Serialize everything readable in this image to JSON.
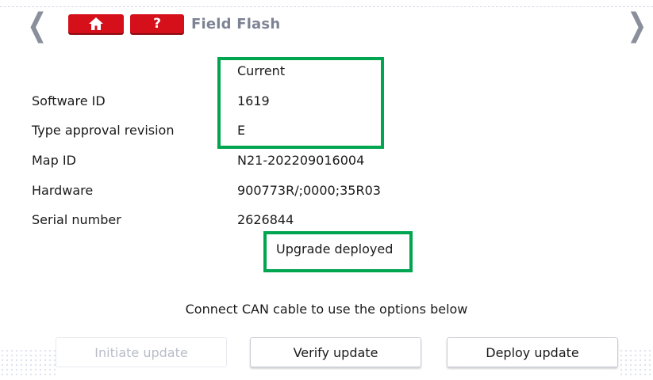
{
  "header": {
    "title": "Field Flash",
    "help_label": "?",
    "icons": {
      "back": "chevron-left-icon",
      "forward": "chevron-right-icon",
      "home": "home-icon"
    }
  },
  "info": {
    "column_header": "Current",
    "rows": [
      {
        "label": "Software ID",
        "value": "1619"
      },
      {
        "label": "Type approval revision",
        "value": "E"
      },
      {
        "label": "Map ID",
        "value": "N21-202209016004"
      },
      {
        "label": "Hardware",
        "value": "900773R/;0000;35R03"
      },
      {
        "label": "Serial number",
        "value": "2626844"
      }
    ],
    "status": "Upgrade deployed"
  },
  "notice": "Connect CAN cable to use the options below",
  "actions": {
    "initiate": "Initiate update",
    "verify": "Verify update",
    "deploy": "Deploy update"
  },
  "colors": {
    "accent_red": "#d5101b",
    "highlight_green": "#00a550",
    "title_gray": "#7d8394"
  }
}
